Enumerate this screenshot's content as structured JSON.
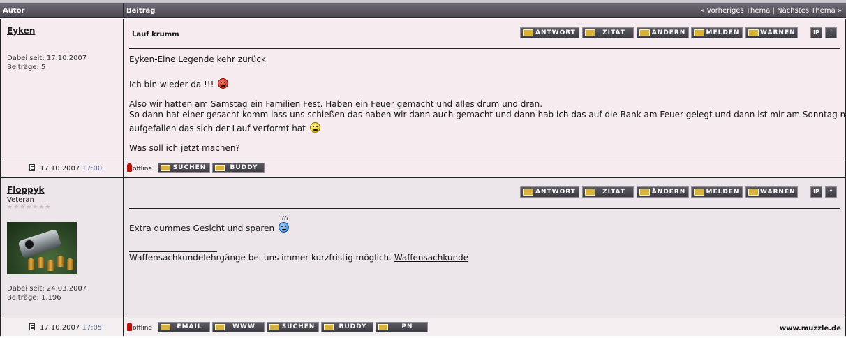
{
  "header": {
    "author_label": "Autor",
    "post_label": "Beitrag",
    "prev_thread": "« Vorheriges Thema",
    "separator": "|",
    "next_thread": "Nächstes Thema »"
  },
  "post_actions": {
    "reply": "ANTWORT",
    "quote": "ZITAT",
    "edit": "ÄNDERN",
    "report": "MELDEN",
    "warn": "WARNEN",
    "ip": "IP",
    "top": "↑"
  },
  "posts": [
    {
      "author": "Eyken",
      "rank": "",
      "member_since": "Dabei seit: 17.10.2007",
      "post_count": "Beiträge: 5",
      "subject": "Lauf krumm",
      "lines": [
        "Eyken-Eine Legende kehr zurück",
        "Ich bin wieder da !!!",
        "Also wir hatten am Samstag ein Familien Fest. Haben ein Feuer gemacht und alles drum und dran.",
        "So dann hat einer gesacht komm lass uns schießen das haben wir dann auch gemacht und dann hab ich das auf die Bank am Feuer gelegt und dann ist mir am Sonntag morgen",
        "aufgefallen das sich der Lauf verformt hat",
        "Was soll ich jetzt machen?"
      ],
      "date": "17.10.2007",
      "time": "17:00",
      "status": "offline",
      "footer_buttons": [
        "SUCHEN",
        "BUDDY"
      ]
    },
    {
      "author": "Floppyk",
      "rank": "Veteran",
      "stars": "★★★★★★★",
      "member_since": "Dabei seit: 24.03.2007",
      "post_count": "Beiträge: 1.196",
      "smiley_caption": "???",
      "lines": [
        "Extra dummes Gesicht und sparen"
      ],
      "signature": {
        "line": "_________________",
        "text": "Waffensachkundelehrgänge bei uns immer kurzfristig möglich.",
        "link": "Waffensachkunde"
      },
      "date": "17.10.2007",
      "time": "17:05",
      "status": "offline",
      "footer_buttons": [
        "EMAIL",
        "WWW",
        "SUCHEN",
        "BUDDY",
        "PN"
      ],
      "site": "www.muzzle.de"
    }
  ],
  "icons": {
    "post_smiley_1": "angry-red-smiley-icon",
    "post_smiley_2": "confused-yellow-smiley-icon",
    "post_smiley_3": "questioning-blue-smiley-icon",
    "doc": "document-icon",
    "offline": "offline-figure-icon"
  },
  "colors": {
    "header_bg": "#5a5762",
    "post1_bg": "#f6ecef",
    "post2_bg": "#ece6ea",
    "time_color": "#5a6f9a"
  }
}
